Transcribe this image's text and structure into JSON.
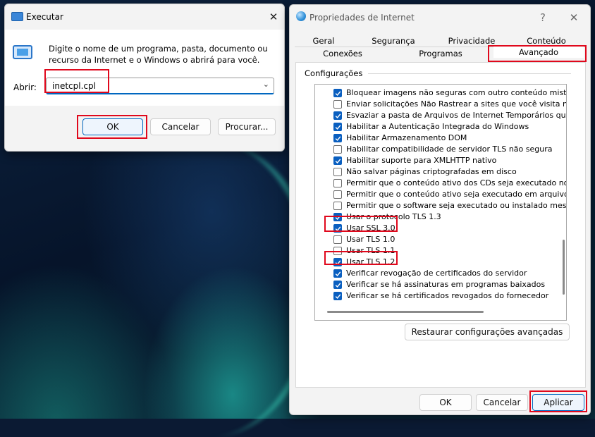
{
  "run_dialog": {
    "title": "Executar",
    "description_line1": "Digite o nome de um programa, pasta, documento ou",
    "description_line2": "recurso da Internet e o Windows o abrirá para você.",
    "open_label": "Abrir:",
    "open_value": "inetcpl.cpl",
    "ok_label": "OK",
    "cancel_label": "Cancelar",
    "browse_label": "Procurar..."
  },
  "internet_properties": {
    "title": "Propriedades de Internet",
    "help_label": "?",
    "tabs_row1": [
      "Geral",
      "Segurança",
      "Privacidade",
      "Conteúdo"
    ],
    "tabs_row2": [
      "Conexões",
      "Programas",
      "Avançado"
    ],
    "active_tab": "Avançado",
    "settings_group_label": "Configurações",
    "settings": [
      {
        "label": "Bloquear imagens não seguras com outro conteúdo misto",
        "checked": true
      },
      {
        "label": "Enviar solicitações Não Rastrear a sites que você visita no Inte",
        "checked": false
      },
      {
        "label": "Esvaziar a pasta de Arquivos de Internet Temporários quando",
        "checked": true
      },
      {
        "label": "Habilitar a Autenticação Integrada do Windows",
        "checked": true
      },
      {
        "label": "Habilitar Armazenamento DOM",
        "checked": true
      },
      {
        "label": "Habilitar compatibilidade de servidor TLS não segura",
        "checked": false
      },
      {
        "label": "Habilitar suporte para XMLHTTP nativo",
        "checked": true
      },
      {
        "label": "Não salvar páginas criptografadas em disco",
        "checked": false
      },
      {
        "label": "Permitir que o conteúdo ativo dos CDs seja executado no Meu",
        "checked": false
      },
      {
        "label": "Permitir que o conteúdo ativo seja executado em arquivos no M",
        "checked": false
      },
      {
        "label": "Permitir que o software seja executado ou instalado mesmo qu",
        "checked": false
      },
      {
        "label": "Usar o protocolo TLS 1.3",
        "checked": true
      },
      {
        "label": "Usar SSL 3.0",
        "checked": true
      },
      {
        "label": "Usar TLS 1.0",
        "checked": false
      },
      {
        "label": "Usar TLS 1.1",
        "checked": false
      },
      {
        "label": "Usar TLS 1.2",
        "checked": true
      },
      {
        "label": "Verificar revogação de certificados do servidor",
        "checked": true
      },
      {
        "label": "Verificar se há assinaturas em programas baixados",
        "checked": true
      },
      {
        "label": "Verificar se há certificados revogados do fornecedor",
        "checked": true
      }
    ],
    "restore_label": "Restaurar configurações avançadas",
    "ok_label": "OK",
    "cancel_label": "Cancelar",
    "apply_label": "Aplicar"
  },
  "colors": {
    "highlight": "#e0081c",
    "checkbox_accent": "#0a5fc0"
  }
}
